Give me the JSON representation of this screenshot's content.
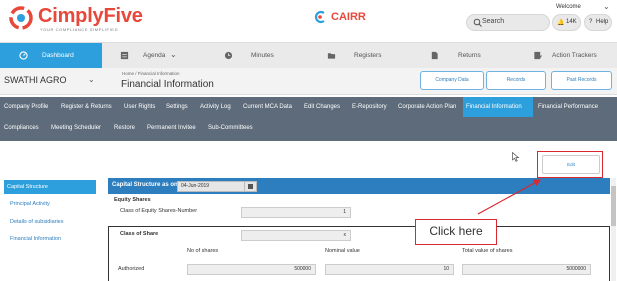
{
  "header": {
    "brand": "CimplyFive",
    "tagline": "YOUR COMPLIANCE SIMPLIFIED",
    "cairr_label": "CAIRR",
    "welcome_label": "Welcome",
    "search_label": "Search",
    "notification_count": "14K",
    "help_label": "Help",
    "brand_color": "#e8473a"
  },
  "main_nav": {
    "items": [
      {
        "label": "Dashboard",
        "icon": "dashboard-icon",
        "active": true
      },
      {
        "label": "Agenda",
        "icon": "agenda-icon",
        "active": false
      },
      {
        "label": "Minutes",
        "icon": "clock-icon",
        "active": false
      },
      {
        "label": "Registers",
        "icon": "folder-icon",
        "active": false
      },
      {
        "label": "Returns",
        "icon": "document-icon",
        "active": false
      },
      {
        "label": "Action Trackers",
        "icon": "checklist-icon",
        "active": false
      }
    ],
    "active_color": "#2d9fdd"
  },
  "company_bar": {
    "company_name": "SWATHI AGRO",
    "breadcrumb": "Home  /  Financial Information",
    "page_title": "Financial Information",
    "buttons": [
      "Company Data",
      "Records",
      "Past Records"
    ]
  },
  "sub_nav": {
    "row1": [
      "Company Profile",
      "Register & Returns",
      "User Rights",
      "Settings",
      "Activity Log",
      "Current MCA Data",
      "Edit Changes",
      "E-Repository",
      "Corporate Action Plan",
      "Financial Information",
      "Financial Performance"
    ],
    "row2": [
      "Compliances",
      "Meeting Scheduler",
      "Restore",
      "Permanent Invitee",
      "Sub-Committees"
    ],
    "active": "Financial Information",
    "background": "#5d6b7a"
  },
  "content": {
    "edit_label": "Edit",
    "sidebar": [
      "Capital Structure",
      "Principal Activity",
      "Details of subsidiaries",
      "Financial Information"
    ],
    "capital_structure_label": "Capital Structure as on",
    "date_value": "04-Jun-2019",
    "equity_shares_label": "Equity Shares",
    "class_count_label": "Class of Equity Shares-Number",
    "class_count_value": "1",
    "class_of_share_label": "Class of Share",
    "class_of_share_value": "x",
    "columns": [
      "No of shares",
      "Nominal value",
      "Total value of shares"
    ],
    "authorized_label": "Authorized",
    "authorized_values": [
      "500000",
      "10",
      "5000000"
    ],
    "callout_text": "Click here",
    "callout_color": "#d9282f"
  }
}
